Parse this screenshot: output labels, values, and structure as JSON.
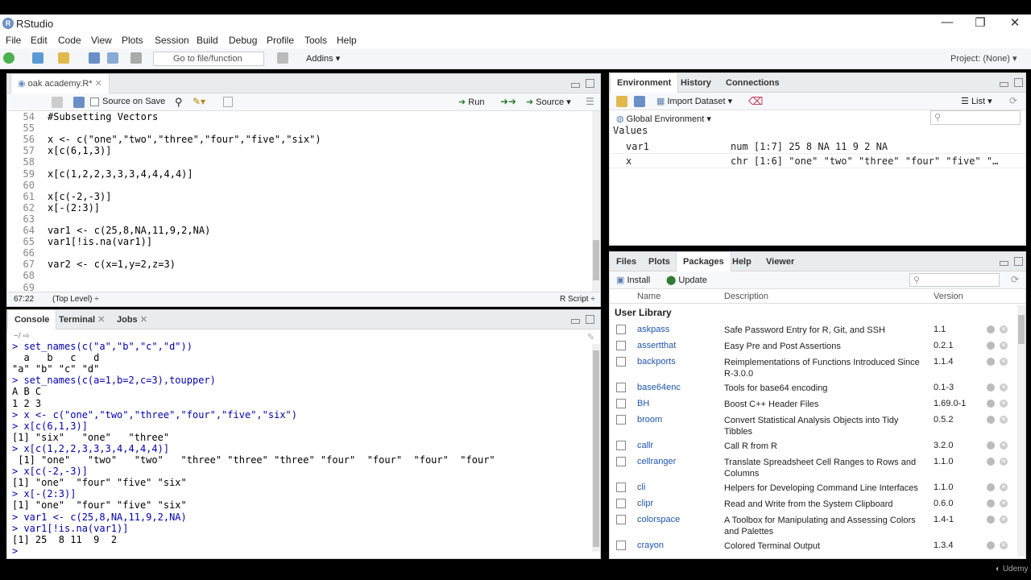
{
  "window": {
    "title": "RStudio",
    "min": "—",
    "restore": "❐",
    "close": "✕"
  },
  "menu": [
    "File",
    "Edit",
    "Code",
    "View",
    "Plots",
    "Session",
    "Build",
    "Debug",
    "Profile",
    "Tools",
    "Help"
  ],
  "toolbar": {
    "goto_placeholder": "Go to file/function",
    "addins": "Addins",
    "project": "Project: (None)"
  },
  "editor": {
    "tab": "oak academy.R*",
    "source_on_save": "Source on Save",
    "run": "Run",
    "source": "Source",
    "lines": [
      {
        "n": "54",
        "t": "#Subsetting Vectors"
      },
      {
        "n": "55",
        "t": ""
      },
      {
        "n": "56",
        "t": "x <- c(\"one\",\"two\",\"three\",\"four\",\"five\",\"six\")"
      },
      {
        "n": "57",
        "t": "x[c(6,1,3)]"
      },
      {
        "n": "58",
        "t": ""
      },
      {
        "n": "59",
        "t": "x[c(1,2,2,3,3,3,4,4,4,4)]"
      },
      {
        "n": "60",
        "t": ""
      },
      {
        "n": "61",
        "t": "x[c(-2,-3)]"
      },
      {
        "n": "62",
        "t": "x[-(2:3)]"
      },
      {
        "n": "63",
        "t": ""
      },
      {
        "n": "64",
        "t": "var1 <- c(25,8,NA,11,9,2,NA)"
      },
      {
        "n": "65",
        "t": "var1[!is.na(var1)]"
      },
      {
        "n": "66",
        "t": ""
      },
      {
        "n": "67",
        "t": "var2 <- c(x=1,y=2,z=3)"
      },
      {
        "n": "68",
        "t": ""
      },
      {
        "n": "69",
        "t": ""
      }
    ],
    "status_pos": "67:22",
    "status_level": "(Top Level) ÷",
    "status_type": "R Script ÷"
  },
  "console": {
    "tabs": [
      "Console",
      "Terminal",
      "Jobs"
    ],
    "path": "~/",
    "lines": [
      {
        "c": "prompt",
        "t": "> set_names(c(\"a\",\"b\",\"c\",\"d\"))"
      },
      {
        "c": "out",
        "t": "  a   b   c   d"
      },
      {
        "c": "out",
        "t": "\"a\" \"b\" \"c\" \"d\""
      },
      {
        "c": "prompt",
        "t": "> set_names(c(a=1,b=2,c=3),toupper)"
      },
      {
        "c": "out",
        "t": "A B C"
      },
      {
        "c": "out",
        "t": "1 2 3"
      },
      {
        "c": "prompt",
        "t": "> x <- c(\"one\",\"two\",\"three\",\"four\",\"five\",\"six\")"
      },
      {
        "c": "prompt",
        "t": "> x[c(6,1,3)]"
      },
      {
        "c": "out",
        "t": "[1] \"six\"   \"one\"   \"three\""
      },
      {
        "c": "prompt",
        "t": "> x[c(1,2,2,3,3,3,4,4,4,4)]"
      },
      {
        "c": "out",
        "t": " [1] \"one\"   \"two\"   \"two\"   \"three\" \"three\" \"three\" \"four\"  \"four\"  \"four\"  \"four\""
      },
      {
        "c": "prompt",
        "t": "> x[c(-2,-3)]"
      },
      {
        "c": "out",
        "t": "[1] \"one\"  \"four\" \"five\" \"six\""
      },
      {
        "c": "prompt",
        "t": "> x[-(2:3)]"
      },
      {
        "c": "out",
        "t": "[1] \"one\"  \"four\" \"five\" \"six\""
      },
      {
        "c": "prompt",
        "t": "> var1 <- c(25,8,NA,11,9,2,NA)"
      },
      {
        "c": "prompt",
        "t": "> var1[!is.na(var1)]"
      },
      {
        "c": "out",
        "t": "[1] 25  8 11  9  2"
      },
      {
        "c": "prompt",
        "t": "> "
      }
    ]
  },
  "environment": {
    "tabs": [
      "Environment",
      "History",
      "Connections"
    ],
    "import": "Import Dataset",
    "view_mode": "List",
    "scope": "Global Environment",
    "section": "Values",
    "rows": [
      {
        "name": "var1",
        "value": "num [1:7] 25 8 NA 11 9 2 NA"
      },
      {
        "name": "x",
        "value": "chr [1:6] \"one\" \"two\" \"three\" \"four\" \"five\" \"…"
      }
    ]
  },
  "files": {
    "tabs": [
      "Files",
      "Plots",
      "Packages",
      "Help",
      "Viewer"
    ],
    "install": "Install",
    "update": "Update",
    "col_name": "Name",
    "col_desc": "Description",
    "col_ver": "Version",
    "section": "User Library",
    "packages": [
      {
        "name": "askpass",
        "desc": "Safe Password Entry for R, Git, and SSH",
        "desc2": "",
        "ver": "1.1"
      },
      {
        "name": "assertthat",
        "desc": "Easy Pre and Post Assertions",
        "desc2": "",
        "ver": "0.2.1"
      },
      {
        "name": "backports",
        "desc": "Reimplementations of Functions Introduced Since",
        "desc2": "R-3.0.0",
        "ver": "1.1.4"
      },
      {
        "name": "base64enc",
        "desc": "Tools for base64 encoding",
        "desc2": "",
        "ver": "0.1-3"
      },
      {
        "name": "BH",
        "desc": "Boost C++ Header Files",
        "desc2": "",
        "ver": "1.69.0-1"
      },
      {
        "name": "broom",
        "desc": "Convert Statistical Analysis Objects into Tidy",
        "desc2": "Tibbles",
        "ver": "0.5.2"
      },
      {
        "name": "callr",
        "desc": "Call R from R",
        "desc2": "",
        "ver": "3.2.0"
      },
      {
        "name": "cellranger",
        "desc": "Translate Spreadsheet Cell Ranges to Rows and",
        "desc2": "Columns",
        "ver": "1.1.0"
      },
      {
        "name": "cli",
        "desc": "Helpers for Developing Command Line Interfaces",
        "desc2": "",
        "ver": "1.1.0"
      },
      {
        "name": "clipr",
        "desc": "Read and Write from the System Clipboard",
        "desc2": "",
        "ver": "0.6.0"
      },
      {
        "name": "colorspace",
        "desc": "A Toolbox for Manipulating and Assessing Colors",
        "desc2": "and Palettes",
        "ver": "1.4-1"
      },
      {
        "name": "crayon",
        "desc": "Colored Terminal Output",
        "desc2": "",
        "ver": "1.3.4"
      }
    ]
  },
  "watermark": "Udemy"
}
